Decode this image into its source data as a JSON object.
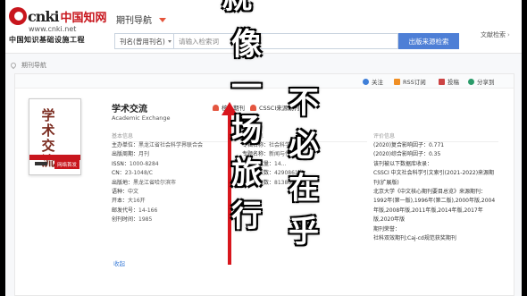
{
  "header": {
    "logo_word": "cnki",
    "logo_cn": "中国知网",
    "logo_url": "www.cnki.net",
    "logo_sub": "中国知识基础设施工程",
    "nav_select": "期刊导航",
    "search_type": "刊名(曾用刊名)",
    "search_placeholder": "请输入检索词",
    "search_button": "出版来源检索",
    "legacy_link": "文献检索"
  },
  "breadcrumb": {
    "label": "期刊导航"
  },
  "toolbar": {
    "favorite": "关注",
    "rss": "RSS订阅",
    "subscribe": "投稿",
    "share": "分享到"
  },
  "journal": {
    "cover_title": "学术交流",
    "cover_tag": "网络首发",
    "title": "学术交流",
    "en_title": "Academic Exchange",
    "badge_core": "核心期刊",
    "badge_cssci": "CSSCI来源期刊"
  },
  "basic": {
    "section": "基本信息",
    "rows": [
      {
        "k": "主办单位：",
        "v": "黑龙江省社会科学界联合会"
      },
      {
        "k": "出版周期：",
        "v": "月刊"
      },
      {
        "k": "ISSN：",
        "v": "1000-8284"
      },
      {
        "k": "CN：",
        "v": "23-1048/C"
      },
      {
        "k": "出版地：",
        "v": "黑龙江省哈尔滨市"
      },
      {
        "k": "语种：",
        "v": "中文"
      },
      {
        "k": "开本：",
        "v": "大16开"
      },
      {
        "k": "邮发代号：",
        "v": "14-166"
      },
      {
        "k": "创刊时间：",
        "v": "1985"
      }
    ],
    "more": "收起"
  },
  "publish": {
    "section": "出版信息",
    "rows": [
      {
        "k": "专辑名称：",
        "v": "社会科学"
      },
      {
        "k": "专题名称：",
        "v": "新闻与传媒"
      },
      {
        "k": "出版文献量：",
        "v": "14..."
      },
      {
        "k": "总下载次数：",
        "v": "4290861次"
      },
      {
        "k": "总被引次数：",
        "v": "81380次"
      }
    ]
  },
  "evaluation": {
    "section": "评价信息",
    "lines": [
      "(2020)复合影响因子：0.771",
      "(2020)综合影响因子：0.35",
      "该刊被以下数据库收录：",
      "CSSCI 中文社会科学引文索引(2021-2022)来源期刊(扩展版)",
      "北京大学《中文核心期刊要目总览》来源期刊：",
      "1992年(第一版),1996年(第二版),2000年版,2004年版,2008年版,2011年版,2014年版,2017年版,2020年版",
      "期刊荣誉：",
      "社科双效期刊;Caj-cd规范获奖期刊"
    ]
  },
  "overlay": {
    "col_mid": [
      "像",
      "一",
      "场",
      "旅",
      "行"
    ],
    "col_right": [
      "不",
      "必",
      "在",
      "乎"
    ],
    "top": "就"
  },
  "colors": {
    "brand": "#c8161d",
    "search_button": "#4e7fd6",
    "arrow": "#d8161d"
  }
}
